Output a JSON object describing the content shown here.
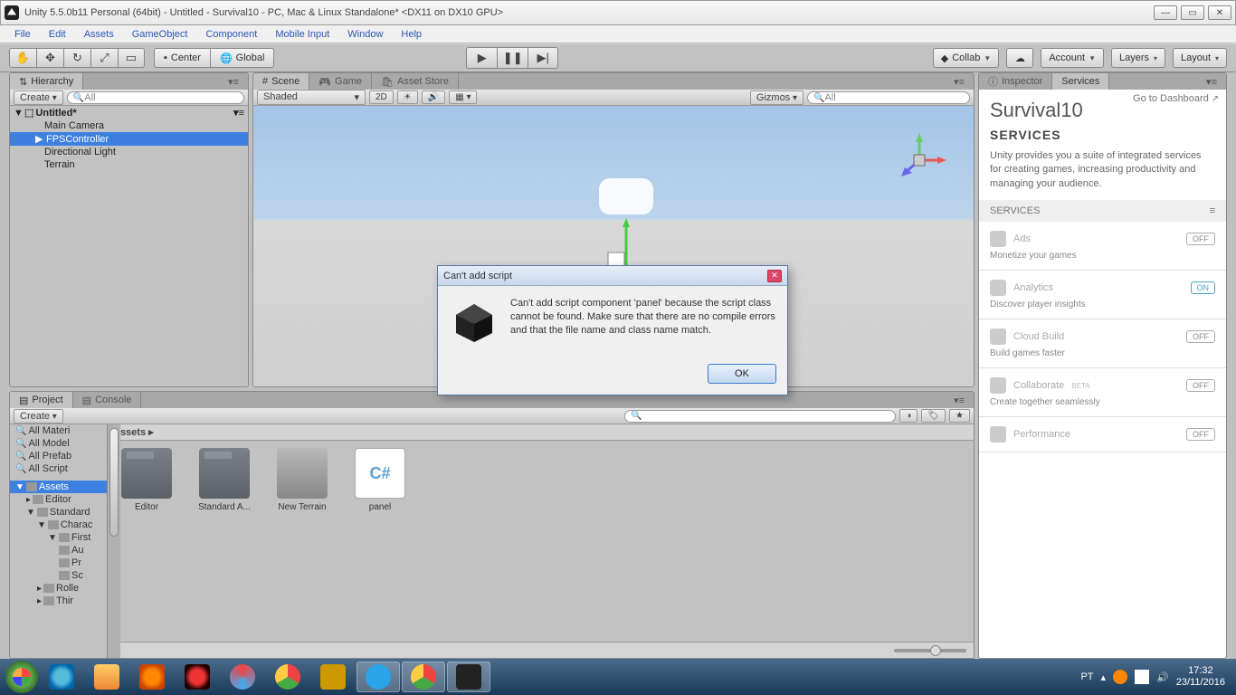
{
  "titlebar": {
    "text": "Unity 5.5.0b11 Personal (64bit) - Untitled - Survival10 - PC, Mac & Linux Standalone* <DX11 on DX10 GPU>"
  },
  "menu": [
    "File",
    "Edit",
    "Assets",
    "GameObject",
    "Component",
    "Mobile Input",
    "Window",
    "Help"
  ],
  "toolbar": {
    "center": "Center",
    "global": "Global",
    "collab": "Collab",
    "account": "Account",
    "layers": "Layers",
    "layout": "Layout"
  },
  "hierarchy": {
    "tab": "Hierarchy",
    "create": "Create",
    "search": "All",
    "root": "Untitled*",
    "items": [
      "Main Camera",
      "FPSController",
      "Directional Light",
      "Terrain"
    ],
    "selected": 1
  },
  "sceneTabs": {
    "scene": "Scene",
    "game": "Game",
    "assetstore": "Asset Store"
  },
  "sceneToolbar": {
    "shaded": "Shaded",
    "twoD": "2D",
    "gizmos": "Gizmos",
    "search": "All"
  },
  "project": {
    "tab_project": "Project",
    "tab_console": "Console",
    "create": "Create",
    "breadcrumb": "Assets ▸",
    "favLabels": [
      "All Materi",
      "All Model",
      "All Prefab",
      "All Script"
    ],
    "tree": [
      "Assets",
      "Editor",
      "Standard",
      "Charac",
      "First",
      "Au",
      "Pr",
      "Sc",
      "Rolle",
      "Thir"
    ],
    "assets": [
      {
        "name": "Editor",
        "type": "folder"
      },
      {
        "name": "Standard A...",
        "type": "folder"
      },
      {
        "name": "New Terrain",
        "type": "terrain"
      },
      {
        "name": "panel",
        "type": "cs"
      }
    ]
  },
  "services": {
    "tab_inspector": "Inspector",
    "tab_services": "Services",
    "dashboard": "Go to Dashboard",
    "title": "Survival10",
    "subtitle": "SERVICES",
    "desc": "Unity provides you a suite of integrated services for creating games, increasing productivity and managing your audience.",
    "section": "SERVICES",
    "items": [
      {
        "name": "Ads",
        "desc": "Monetize your games",
        "state": "OFF"
      },
      {
        "name": "Analytics",
        "desc": "Discover player insights",
        "state": "ON"
      },
      {
        "name": "Cloud Build",
        "desc": "Build games faster",
        "state": "OFF"
      },
      {
        "name": "Collaborate",
        "beta": "BETA",
        "desc": "Create together seamlessly",
        "state": "OFF"
      },
      {
        "name": "Performance",
        "desc": "",
        "state": "OFF"
      }
    ]
  },
  "dialog": {
    "title": "Can't add script",
    "text": "Can't add script component 'panel' because the script class cannot be found. Make sure that there are no compile errors and that the file name and class name match.",
    "ok": "OK"
  },
  "taskbar": {
    "lang": "PT",
    "time": "17:32",
    "date": "23/11/2016"
  }
}
